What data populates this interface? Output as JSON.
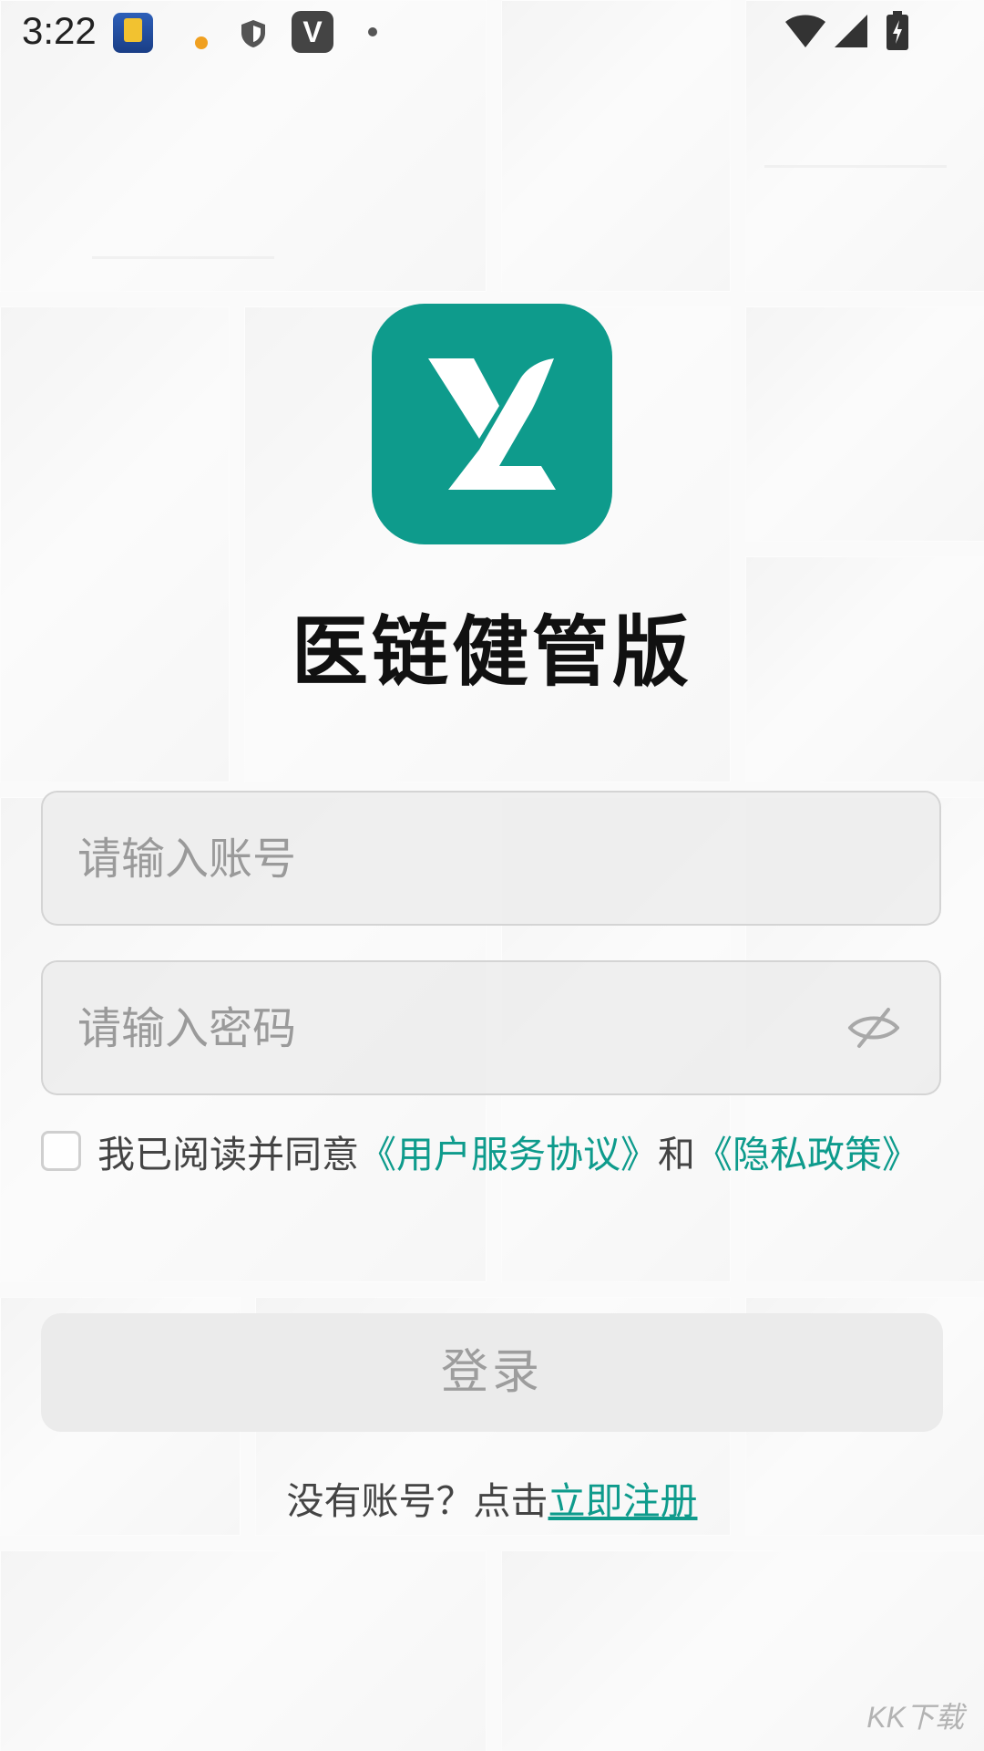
{
  "status_bar": {
    "time": "3:22",
    "icons": [
      "game-app-icon",
      "alert-dot-icon",
      "shield-icon",
      "v-app-icon",
      "dot-icon",
      "wifi-icon",
      "signal-icon",
      "battery-charging-icon"
    ]
  },
  "app": {
    "name": "医链健管版",
    "logo_color": "#0e9b8c"
  },
  "form": {
    "account_placeholder": "请输入账号",
    "password_placeholder": "请输入密码",
    "password_toggle_icon": "eye-off-icon"
  },
  "agreement": {
    "prefix": "我已阅读并同意",
    "user_agreement": "《用户服务协议》",
    "and": "和",
    "privacy_policy": "《隐私政策》",
    "checked": false
  },
  "login_button": "登录",
  "register": {
    "prompt": "没有账号？点击",
    "link": "立即注册"
  },
  "watermark": "KK下载",
  "colors": {
    "accent": "#0e9b8c",
    "button_bg": "#eaeaea",
    "button_text": "#9d9d9d"
  }
}
